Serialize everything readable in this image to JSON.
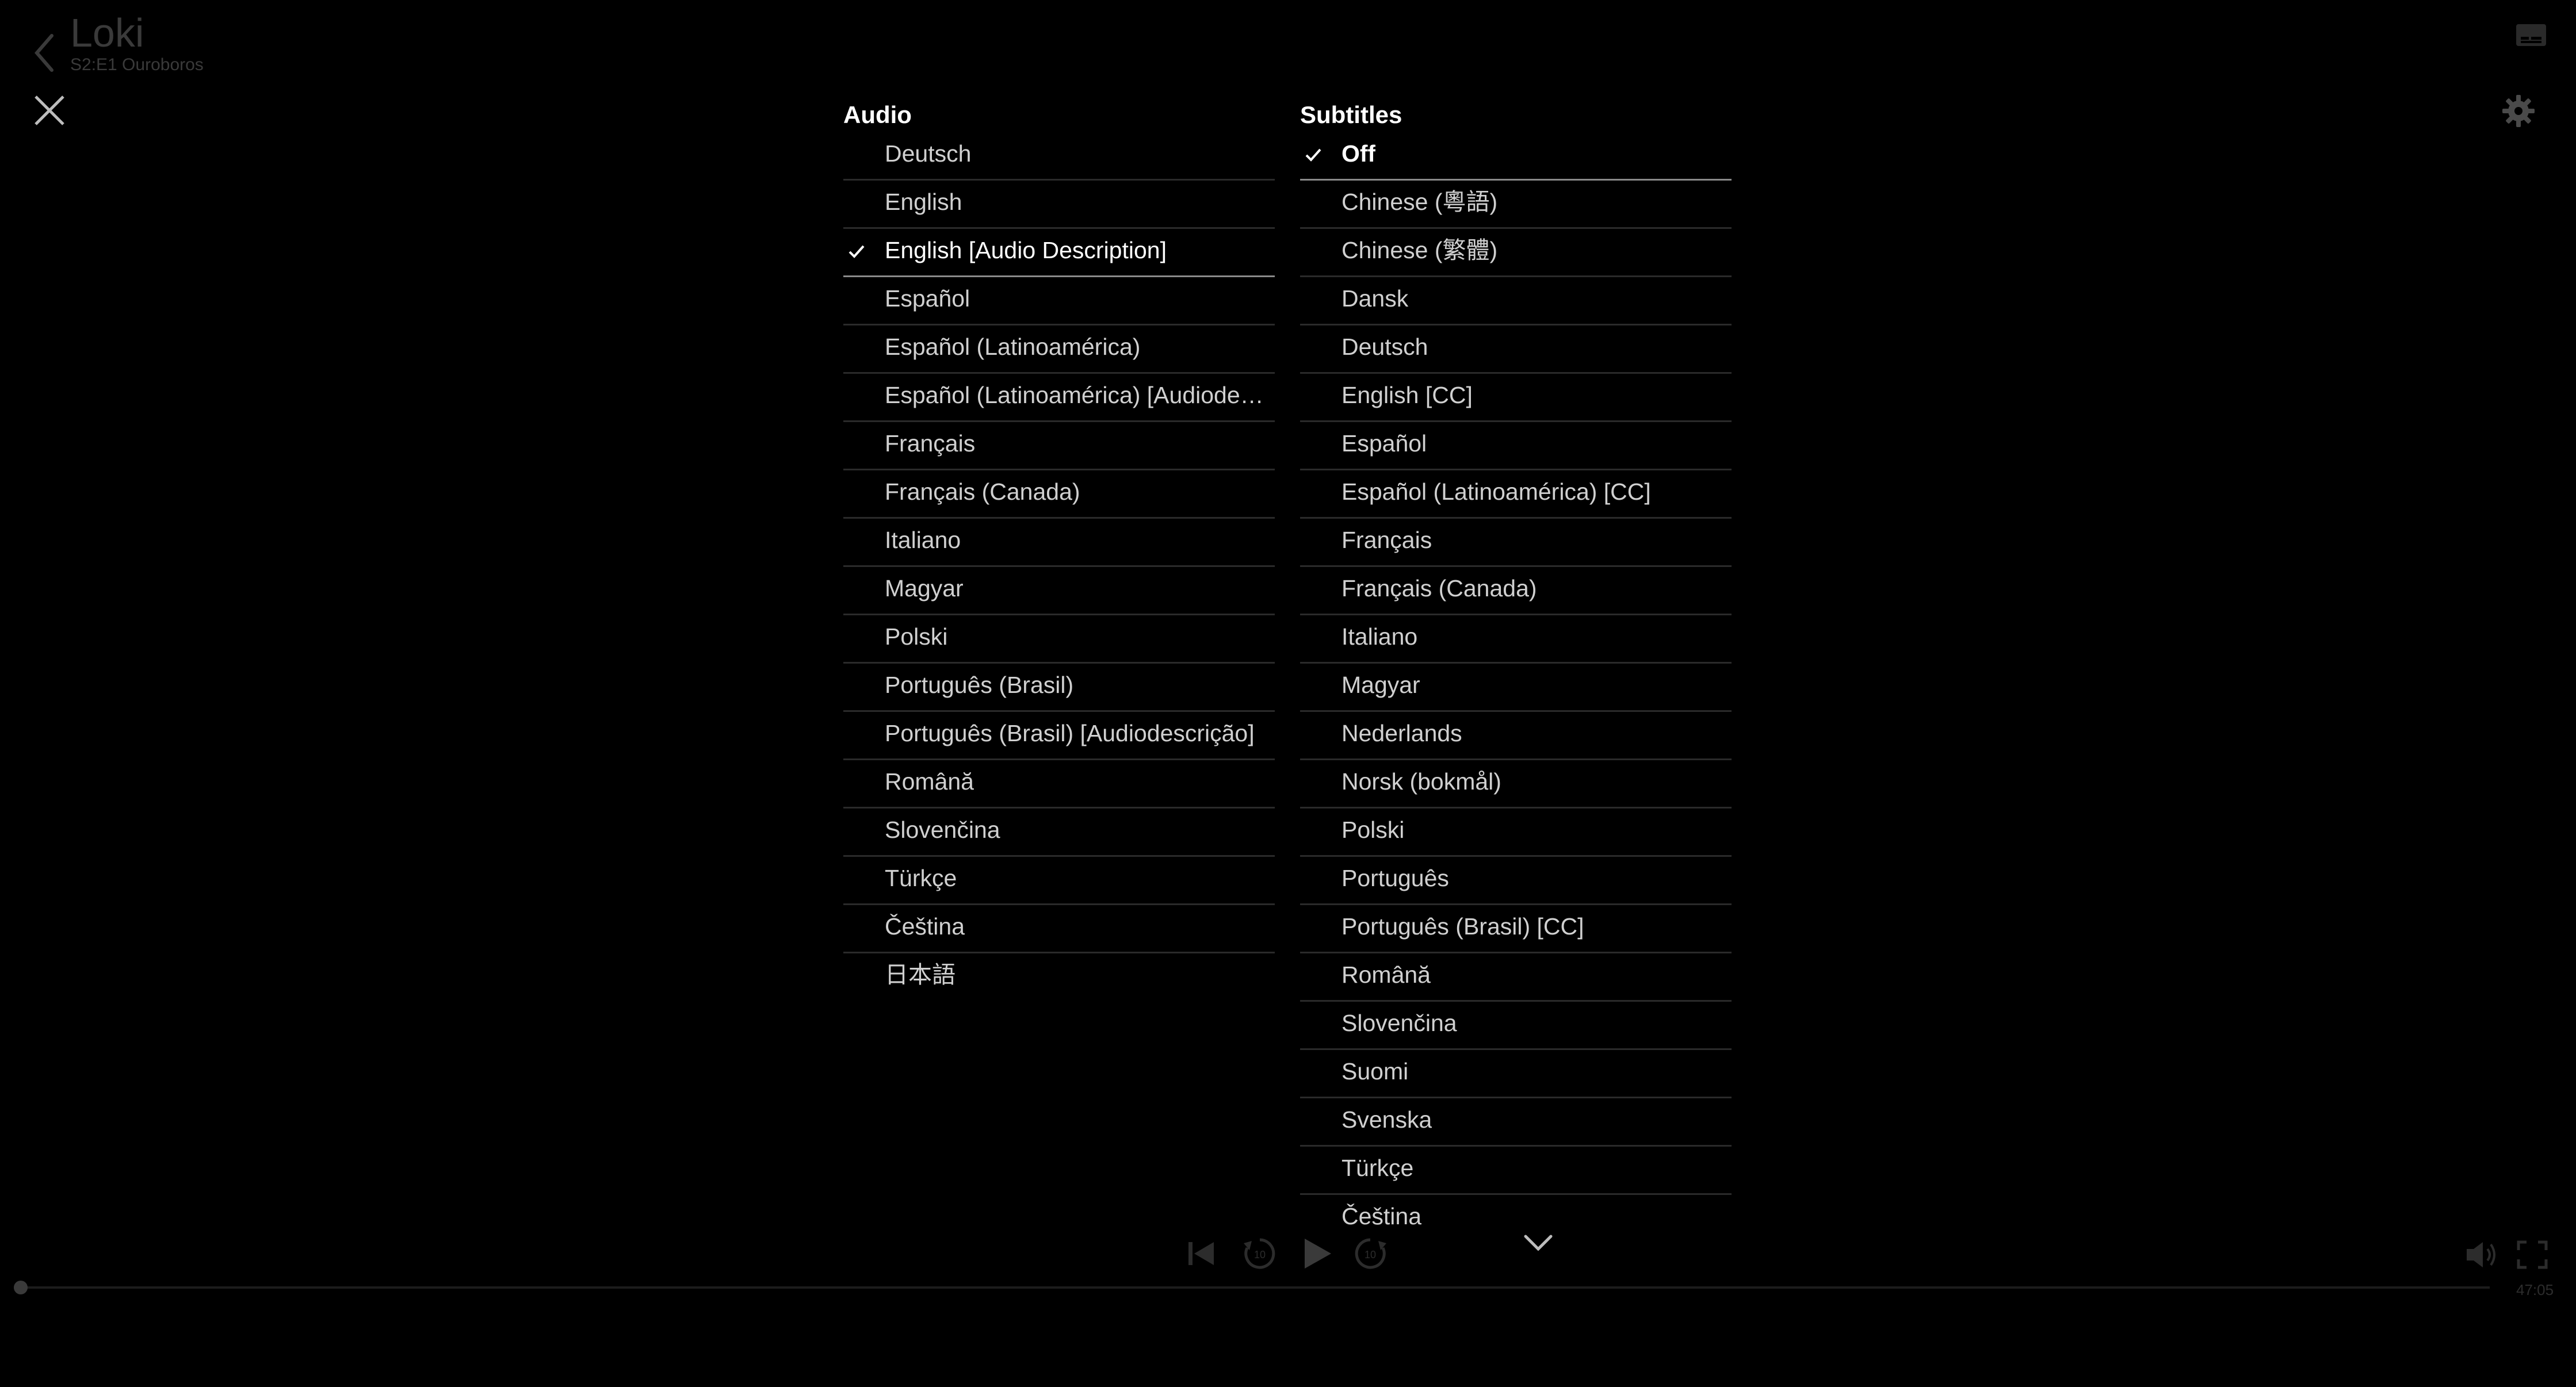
{
  "header": {
    "title": "Loki",
    "episode": "S2:E1 Ouroboros"
  },
  "audio": {
    "heading": "Audio",
    "selected_index": 2,
    "options": [
      "Deutsch",
      "English",
      "English [Audio Description]",
      "Español",
      "Español (Latinoamérica)",
      "Español (Latinoamérica) [Audiodescripción]",
      "Français",
      "Français (Canada)",
      "Italiano",
      "Magyar",
      "Polski",
      "Português (Brasil)",
      "Português (Brasil) [Audiodescrição]",
      "Română",
      "Slovenčina",
      "Türkçe",
      "Čeština",
      "日本語"
    ]
  },
  "subtitles": {
    "heading": "Subtitles",
    "selected_index": 0,
    "options": [
      "Off",
      "Chinese (粵語)",
      "Chinese (繁體)",
      "Dansk",
      "Deutsch",
      "English [CC]",
      "Español",
      "Español (Latinoamérica) [CC]",
      "Français",
      "Français (Canada)",
      "Italiano",
      "Magyar",
      "Nederlands",
      "Norsk (bokmål)",
      "Polski",
      "Português",
      "Português (Brasil) [CC]",
      "Română",
      "Slovenčina",
      "Suomi",
      "Svenska",
      "Türkçe",
      "Čeština"
    ]
  },
  "player": {
    "time_remaining": "47:05",
    "progress_fraction": 0.0
  },
  "colors": {
    "background": "#000000",
    "dim_control": "#3a3a3a",
    "text": "#d0d0d0"
  }
}
